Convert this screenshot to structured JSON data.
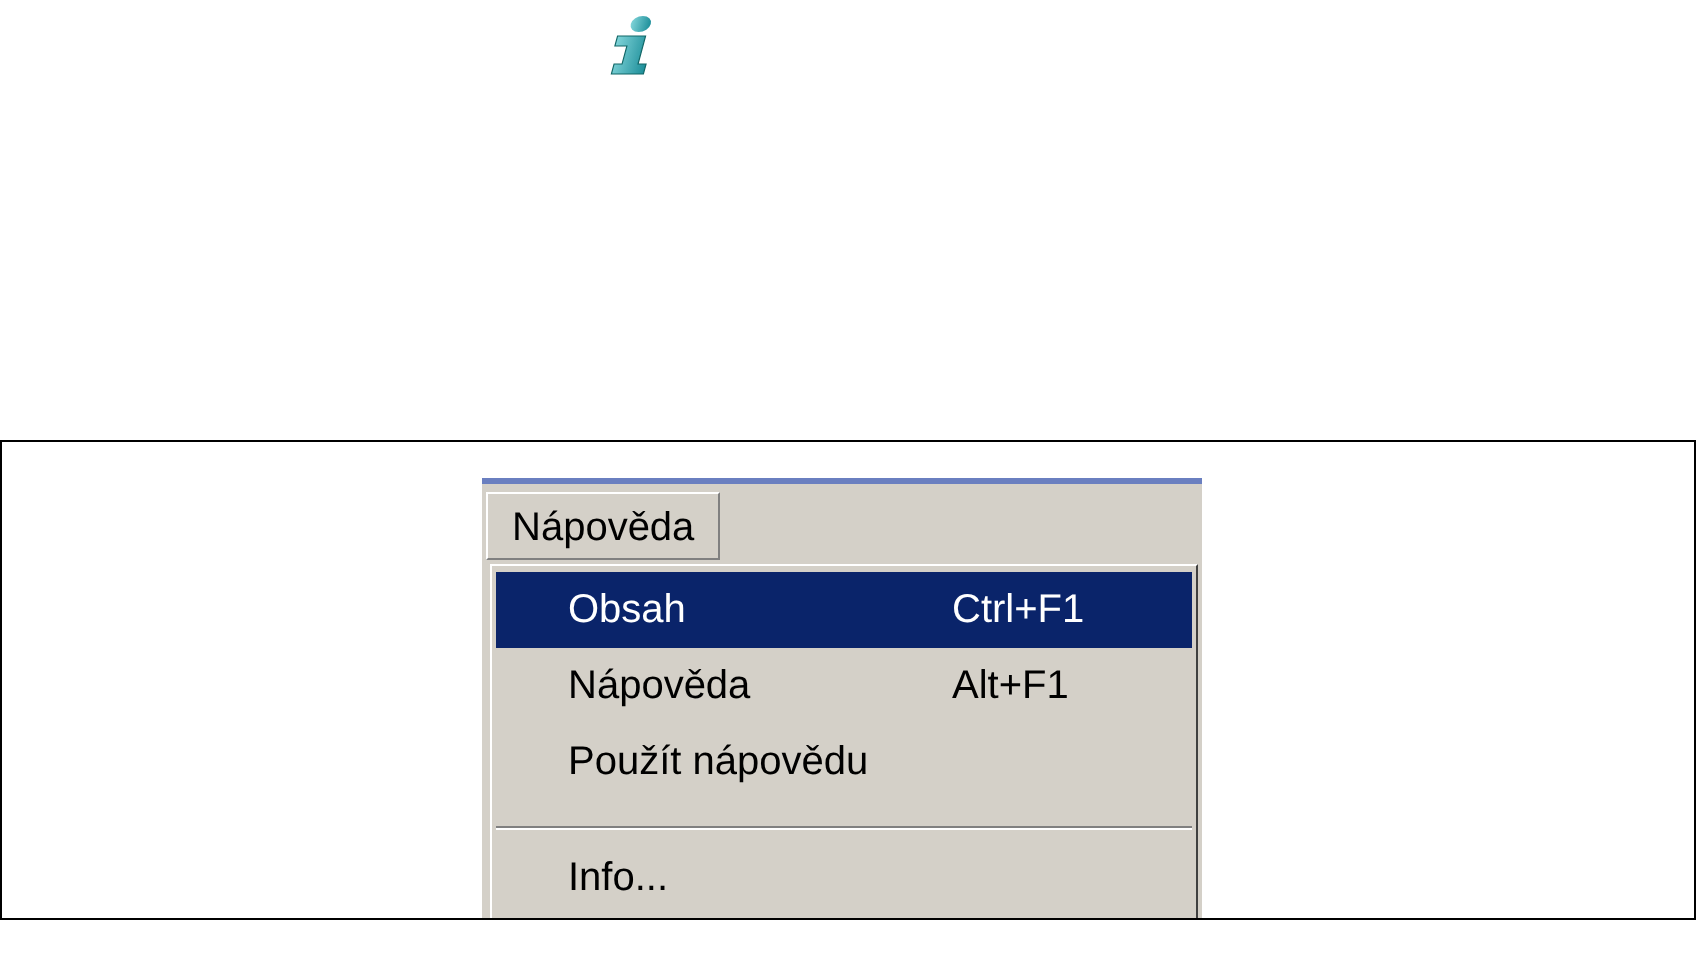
{
  "menu_bar": {
    "menus": [
      {
        "label": "Nápověda",
        "open": true
      }
    ]
  },
  "menu": {
    "items": [
      {
        "kind": "item",
        "label": "Obsah",
        "shortcut": "Ctrl+F1",
        "selected": true
      },
      {
        "kind": "item",
        "label": "Nápověda",
        "shortcut": "Alt+F1",
        "selected": false
      },
      {
        "kind": "item",
        "label": "Použít nápovědu",
        "selected": false
      },
      {
        "kind": "separator"
      },
      {
        "kind": "item",
        "label": "Info...",
        "selected": false
      }
    ]
  }
}
